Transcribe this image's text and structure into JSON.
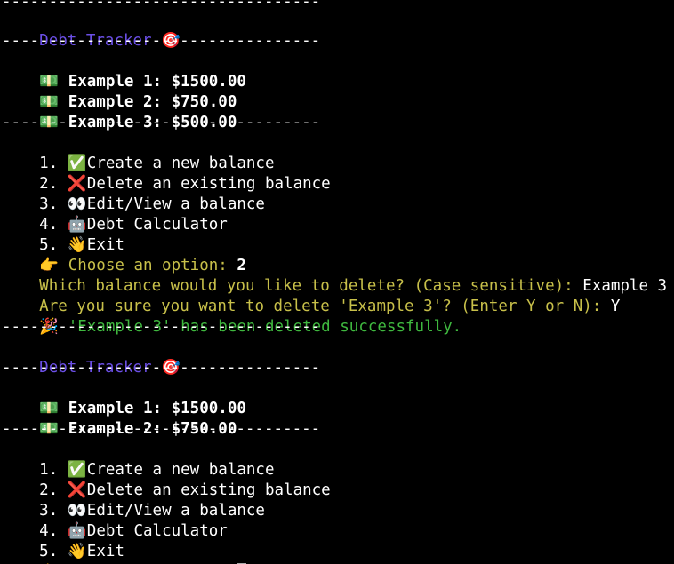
{
  "separator": "----------------------------------",
  "blocks": [
    {
      "title": "Debt Tracker",
      "title_icon": "🎯",
      "balances": [
        {
          "icon": "💵",
          "label": "Example 1:",
          "amount": "$1500.00"
        },
        {
          "icon": "💵",
          "label": "Example 2:",
          "amount": "$750.00"
        },
        {
          "icon": "💵",
          "label": "Example 3:",
          "amount": "$500.00"
        }
      ]
    },
    {
      "title": "Debt Tracker",
      "title_icon": "🎯",
      "balances": [
        {
          "icon": "💵",
          "label": "Example 1:",
          "amount": "$1500.00"
        },
        {
          "icon": "💵",
          "label": "Example 2:",
          "amount": "$750.00"
        }
      ]
    }
  ],
  "menu": [
    {
      "num": "1.",
      "icon": "✅",
      "label": "Create a new balance"
    },
    {
      "num": "2.",
      "icon": "❌",
      "label": "Delete an existing balance"
    },
    {
      "num": "3.",
      "icon": "👀",
      "label": "Edit/View a balance"
    },
    {
      "num": "4.",
      "icon": "🤖",
      "label": "Debt Calculator"
    },
    {
      "num": "5.",
      "icon": "👋",
      "label": "Exit"
    }
  ],
  "prompt": {
    "icon": "👉",
    "text": "Choose an option:",
    "first_answer": "2"
  },
  "delete_dialog": {
    "question": "Which balance would you like to delete? (Case sensitive):",
    "answer": "Example 3",
    "confirm_question": "Are you sure you want to delete 'Example 3'? (Enter Y or N):",
    "confirm_answer": "Y",
    "success_icon": "🎉",
    "success_text": "'Example 3' has been deleted successfully."
  },
  "colors": {
    "background": "#000000",
    "title": "#6b4fe6",
    "prompt": "#c8c04a",
    "success": "#3fb83f",
    "text": "#ffffff"
  }
}
